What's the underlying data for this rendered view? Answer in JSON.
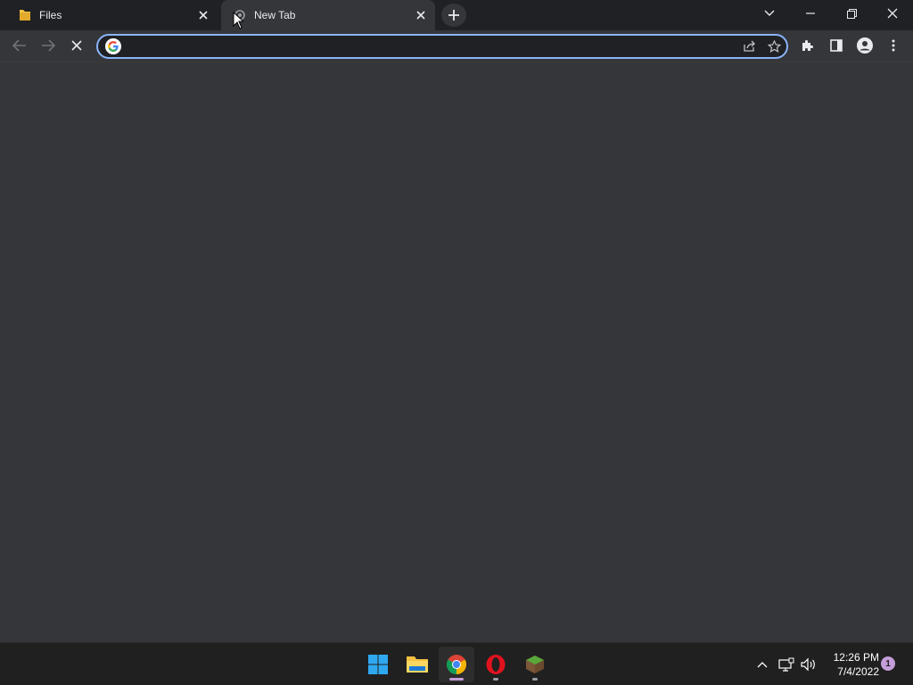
{
  "browser": {
    "tabs": [
      {
        "title": "Files",
        "icon": "folder-icon",
        "active": false
      },
      {
        "title": "New Tab",
        "icon": "loading-spinner-icon",
        "active": true
      }
    ],
    "omnibox": {
      "value": "",
      "placeholder": ""
    },
    "accent_color": "#8ab4f8"
  },
  "taskbar": {
    "apps": [
      "start-icon",
      "file-explorer-icon",
      "chrome-icon",
      "opera-icon",
      "minecraft-icon"
    ],
    "clock": {
      "time": "12:26 PM",
      "date": "7/4/2022"
    },
    "notification_count": "1"
  }
}
